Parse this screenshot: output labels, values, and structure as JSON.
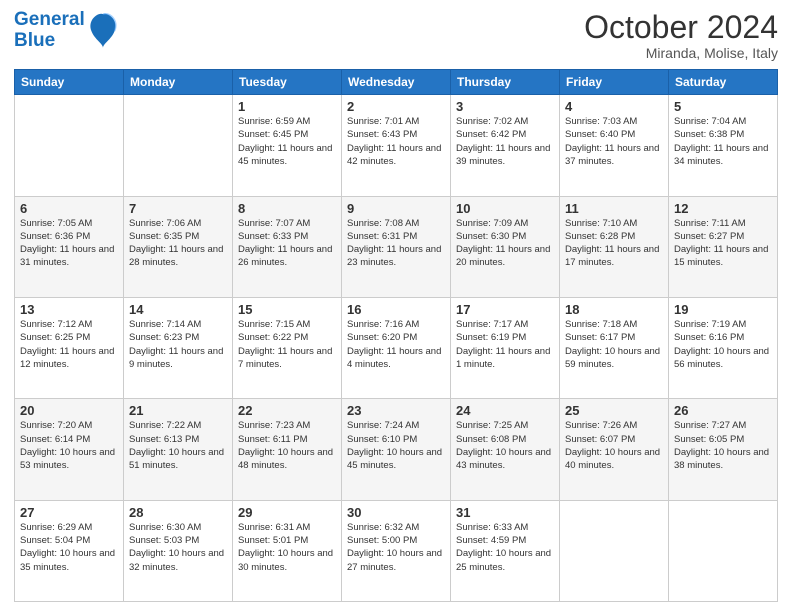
{
  "header": {
    "logo_line1": "General",
    "logo_line2": "Blue",
    "month": "October 2024",
    "location": "Miranda, Molise, Italy"
  },
  "days_of_week": [
    "Sunday",
    "Monday",
    "Tuesday",
    "Wednesday",
    "Thursday",
    "Friday",
    "Saturday"
  ],
  "weeks": [
    [
      {
        "day": "",
        "info": ""
      },
      {
        "day": "",
        "info": ""
      },
      {
        "day": "1",
        "info": "Sunrise: 6:59 AM\nSunset: 6:45 PM\nDaylight: 11 hours and 45 minutes."
      },
      {
        "day": "2",
        "info": "Sunrise: 7:01 AM\nSunset: 6:43 PM\nDaylight: 11 hours and 42 minutes."
      },
      {
        "day": "3",
        "info": "Sunrise: 7:02 AM\nSunset: 6:42 PM\nDaylight: 11 hours and 39 minutes."
      },
      {
        "day": "4",
        "info": "Sunrise: 7:03 AM\nSunset: 6:40 PM\nDaylight: 11 hours and 37 minutes."
      },
      {
        "day": "5",
        "info": "Sunrise: 7:04 AM\nSunset: 6:38 PM\nDaylight: 11 hours and 34 minutes."
      }
    ],
    [
      {
        "day": "6",
        "info": "Sunrise: 7:05 AM\nSunset: 6:36 PM\nDaylight: 11 hours and 31 minutes."
      },
      {
        "day": "7",
        "info": "Sunrise: 7:06 AM\nSunset: 6:35 PM\nDaylight: 11 hours and 28 minutes."
      },
      {
        "day": "8",
        "info": "Sunrise: 7:07 AM\nSunset: 6:33 PM\nDaylight: 11 hours and 26 minutes."
      },
      {
        "day": "9",
        "info": "Sunrise: 7:08 AM\nSunset: 6:31 PM\nDaylight: 11 hours and 23 minutes."
      },
      {
        "day": "10",
        "info": "Sunrise: 7:09 AM\nSunset: 6:30 PM\nDaylight: 11 hours and 20 minutes."
      },
      {
        "day": "11",
        "info": "Sunrise: 7:10 AM\nSunset: 6:28 PM\nDaylight: 11 hours and 17 minutes."
      },
      {
        "day": "12",
        "info": "Sunrise: 7:11 AM\nSunset: 6:27 PM\nDaylight: 11 hours and 15 minutes."
      }
    ],
    [
      {
        "day": "13",
        "info": "Sunrise: 7:12 AM\nSunset: 6:25 PM\nDaylight: 11 hours and 12 minutes."
      },
      {
        "day": "14",
        "info": "Sunrise: 7:14 AM\nSunset: 6:23 PM\nDaylight: 11 hours and 9 minutes."
      },
      {
        "day": "15",
        "info": "Sunrise: 7:15 AM\nSunset: 6:22 PM\nDaylight: 11 hours and 7 minutes."
      },
      {
        "day": "16",
        "info": "Sunrise: 7:16 AM\nSunset: 6:20 PM\nDaylight: 11 hours and 4 minutes."
      },
      {
        "day": "17",
        "info": "Sunrise: 7:17 AM\nSunset: 6:19 PM\nDaylight: 11 hours and 1 minute."
      },
      {
        "day": "18",
        "info": "Sunrise: 7:18 AM\nSunset: 6:17 PM\nDaylight: 10 hours and 59 minutes."
      },
      {
        "day": "19",
        "info": "Sunrise: 7:19 AM\nSunset: 6:16 PM\nDaylight: 10 hours and 56 minutes."
      }
    ],
    [
      {
        "day": "20",
        "info": "Sunrise: 7:20 AM\nSunset: 6:14 PM\nDaylight: 10 hours and 53 minutes."
      },
      {
        "day": "21",
        "info": "Sunrise: 7:22 AM\nSunset: 6:13 PM\nDaylight: 10 hours and 51 minutes."
      },
      {
        "day": "22",
        "info": "Sunrise: 7:23 AM\nSunset: 6:11 PM\nDaylight: 10 hours and 48 minutes."
      },
      {
        "day": "23",
        "info": "Sunrise: 7:24 AM\nSunset: 6:10 PM\nDaylight: 10 hours and 45 minutes."
      },
      {
        "day": "24",
        "info": "Sunrise: 7:25 AM\nSunset: 6:08 PM\nDaylight: 10 hours and 43 minutes."
      },
      {
        "day": "25",
        "info": "Sunrise: 7:26 AM\nSunset: 6:07 PM\nDaylight: 10 hours and 40 minutes."
      },
      {
        "day": "26",
        "info": "Sunrise: 7:27 AM\nSunset: 6:05 PM\nDaylight: 10 hours and 38 minutes."
      }
    ],
    [
      {
        "day": "27",
        "info": "Sunrise: 6:29 AM\nSunset: 5:04 PM\nDaylight: 10 hours and 35 minutes."
      },
      {
        "day": "28",
        "info": "Sunrise: 6:30 AM\nSunset: 5:03 PM\nDaylight: 10 hours and 32 minutes."
      },
      {
        "day": "29",
        "info": "Sunrise: 6:31 AM\nSunset: 5:01 PM\nDaylight: 10 hours and 30 minutes."
      },
      {
        "day": "30",
        "info": "Sunrise: 6:32 AM\nSunset: 5:00 PM\nDaylight: 10 hours and 27 minutes."
      },
      {
        "day": "31",
        "info": "Sunrise: 6:33 AM\nSunset: 4:59 PM\nDaylight: 10 hours and 25 minutes."
      },
      {
        "day": "",
        "info": ""
      },
      {
        "day": "",
        "info": ""
      }
    ]
  ]
}
